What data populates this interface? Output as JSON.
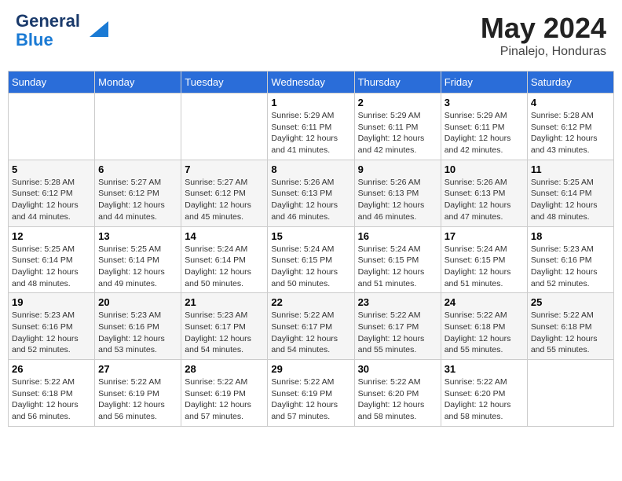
{
  "logo": {
    "line1": "General",
    "line2": "Blue"
  },
  "title": "May 2024",
  "location": "Pinalejo, Honduras",
  "weekdays": [
    "Sunday",
    "Monday",
    "Tuesday",
    "Wednesday",
    "Thursday",
    "Friday",
    "Saturday"
  ],
  "weeks": [
    [
      {
        "day": "",
        "sunrise": "",
        "sunset": "",
        "daylight": ""
      },
      {
        "day": "",
        "sunrise": "",
        "sunset": "",
        "daylight": ""
      },
      {
        "day": "",
        "sunrise": "",
        "sunset": "",
        "daylight": ""
      },
      {
        "day": "1",
        "sunrise": "Sunrise: 5:29 AM",
        "sunset": "Sunset: 6:11 PM",
        "daylight": "Daylight: 12 hours and 41 minutes."
      },
      {
        "day": "2",
        "sunrise": "Sunrise: 5:29 AM",
        "sunset": "Sunset: 6:11 PM",
        "daylight": "Daylight: 12 hours and 42 minutes."
      },
      {
        "day": "3",
        "sunrise": "Sunrise: 5:29 AM",
        "sunset": "Sunset: 6:11 PM",
        "daylight": "Daylight: 12 hours and 42 minutes."
      },
      {
        "day": "4",
        "sunrise": "Sunrise: 5:28 AM",
        "sunset": "Sunset: 6:12 PM",
        "daylight": "Daylight: 12 hours and 43 minutes."
      }
    ],
    [
      {
        "day": "5",
        "sunrise": "Sunrise: 5:28 AM",
        "sunset": "Sunset: 6:12 PM",
        "daylight": "Daylight: 12 hours and 44 minutes."
      },
      {
        "day": "6",
        "sunrise": "Sunrise: 5:27 AM",
        "sunset": "Sunset: 6:12 PM",
        "daylight": "Daylight: 12 hours and 44 minutes."
      },
      {
        "day": "7",
        "sunrise": "Sunrise: 5:27 AM",
        "sunset": "Sunset: 6:12 PM",
        "daylight": "Daylight: 12 hours and 45 minutes."
      },
      {
        "day": "8",
        "sunrise": "Sunrise: 5:26 AM",
        "sunset": "Sunset: 6:13 PM",
        "daylight": "Daylight: 12 hours and 46 minutes."
      },
      {
        "day": "9",
        "sunrise": "Sunrise: 5:26 AM",
        "sunset": "Sunset: 6:13 PM",
        "daylight": "Daylight: 12 hours and 46 minutes."
      },
      {
        "day": "10",
        "sunrise": "Sunrise: 5:26 AM",
        "sunset": "Sunset: 6:13 PM",
        "daylight": "Daylight: 12 hours and 47 minutes."
      },
      {
        "day": "11",
        "sunrise": "Sunrise: 5:25 AM",
        "sunset": "Sunset: 6:14 PM",
        "daylight": "Daylight: 12 hours and 48 minutes."
      }
    ],
    [
      {
        "day": "12",
        "sunrise": "Sunrise: 5:25 AM",
        "sunset": "Sunset: 6:14 PM",
        "daylight": "Daylight: 12 hours and 48 minutes."
      },
      {
        "day": "13",
        "sunrise": "Sunrise: 5:25 AM",
        "sunset": "Sunset: 6:14 PM",
        "daylight": "Daylight: 12 hours and 49 minutes."
      },
      {
        "day": "14",
        "sunrise": "Sunrise: 5:24 AM",
        "sunset": "Sunset: 6:14 PM",
        "daylight": "Daylight: 12 hours and 50 minutes."
      },
      {
        "day": "15",
        "sunrise": "Sunrise: 5:24 AM",
        "sunset": "Sunset: 6:15 PM",
        "daylight": "Daylight: 12 hours and 50 minutes."
      },
      {
        "day": "16",
        "sunrise": "Sunrise: 5:24 AM",
        "sunset": "Sunset: 6:15 PM",
        "daylight": "Daylight: 12 hours and 51 minutes."
      },
      {
        "day": "17",
        "sunrise": "Sunrise: 5:24 AM",
        "sunset": "Sunset: 6:15 PM",
        "daylight": "Daylight: 12 hours and 51 minutes."
      },
      {
        "day": "18",
        "sunrise": "Sunrise: 5:23 AM",
        "sunset": "Sunset: 6:16 PM",
        "daylight": "Daylight: 12 hours and 52 minutes."
      }
    ],
    [
      {
        "day": "19",
        "sunrise": "Sunrise: 5:23 AM",
        "sunset": "Sunset: 6:16 PM",
        "daylight": "Daylight: 12 hours and 52 minutes."
      },
      {
        "day": "20",
        "sunrise": "Sunrise: 5:23 AM",
        "sunset": "Sunset: 6:16 PM",
        "daylight": "Daylight: 12 hours and 53 minutes."
      },
      {
        "day": "21",
        "sunrise": "Sunrise: 5:23 AM",
        "sunset": "Sunset: 6:17 PM",
        "daylight": "Daylight: 12 hours and 54 minutes."
      },
      {
        "day": "22",
        "sunrise": "Sunrise: 5:22 AM",
        "sunset": "Sunset: 6:17 PM",
        "daylight": "Daylight: 12 hours and 54 minutes."
      },
      {
        "day": "23",
        "sunrise": "Sunrise: 5:22 AM",
        "sunset": "Sunset: 6:17 PM",
        "daylight": "Daylight: 12 hours and 55 minutes."
      },
      {
        "day": "24",
        "sunrise": "Sunrise: 5:22 AM",
        "sunset": "Sunset: 6:18 PM",
        "daylight": "Daylight: 12 hours and 55 minutes."
      },
      {
        "day": "25",
        "sunrise": "Sunrise: 5:22 AM",
        "sunset": "Sunset: 6:18 PM",
        "daylight": "Daylight: 12 hours and 55 minutes."
      }
    ],
    [
      {
        "day": "26",
        "sunrise": "Sunrise: 5:22 AM",
        "sunset": "Sunset: 6:18 PM",
        "daylight": "Daylight: 12 hours and 56 minutes."
      },
      {
        "day": "27",
        "sunrise": "Sunrise: 5:22 AM",
        "sunset": "Sunset: 6:19 PM",
        "daylight": "Daylight: 12 hours and 56 minutes."
      },
      {
        "day": "28",
        "sunrise": "Sunrise: 5:22 AM",
        "sunset": "Sunset: 6:19 PM",
        "daylight": "Daylight: 12 hours and 57 minutes."
      },
      {
        "day": "29",
        "sunrise": "Sunrise: 5:22 AM",
        "sunset": "Sunset: 6:19 PM",
        "daylight": "Daylight: 12 hours and 57 minutes."
      },
      {
        "day": "30",
        "sunrise": "Sunrise: 5:22 AM",
        "sunset": "Sunset: 6:20 PM",
        "daylight": "Daylight: 12 hours and 58 minutes."
      },
      {
        "day": "31",
        "sunrise": "Sunrise: 5:22 AM",
        "sunset": "Sunset: 6:20 PM",
        "daylight": "Daylight: 12 hours and 58 minutes."
      },
      {
        "day": "",
        "sunrise": "",
        "sunset": "",
        "daylight": ""
      }
    ]
  ]
}
